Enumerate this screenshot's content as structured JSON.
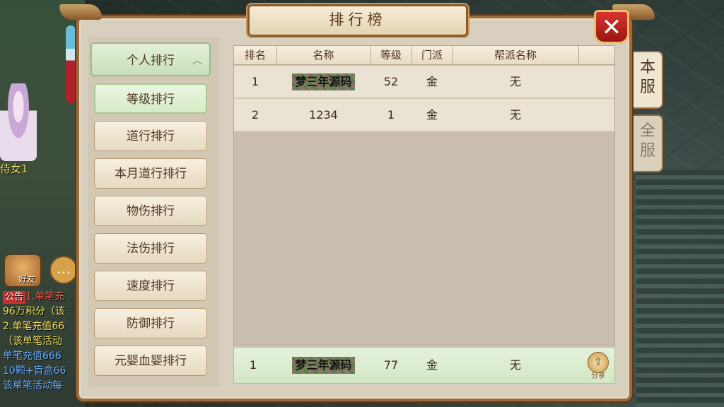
{
  "window": {
    "title": "排行榜",
    "close_label": "✕"
  },
  "menu": {
    "group_label": "个人排行",
    "items": [
      {
        "label": "等级排行",
        "active": true
      },
      {
        "label": "道行排行"
      },
      {
        "label": "本月道行排行"
      },
      {
        "label": "物伤排行"
      },
      {
        "label": "法伤排行"
      },
      {
        "label": "速度排行"
      },
      {
        "label": "防御排行"
      },
      {
        "label": "元婴血婴排行"
      }
    ]
  },
  "table": {
    "columns": [
      "排名",
      "名称",
      "等级",
      "门派",
      "帮派名称"
    ],
    "rows": [
      {
        "rank": "1",
        "name": "梦三年源码",
        "level": "52",
        "school": "金",
        "guild": "无",
        "masked": true
      },
      {
        "rank": "2",
        "name": "1234",
        "level": "1",
        "school": "金",
        "guild": "无",
        "masked": false
      }
    ]
  },
  "self_row": {
    "rank": "1",
    "name": "梦三年源码",
    "level": "77",
    "school": "金",
    "guild": "无"
  },
  "share": {
    "label": "分享"
  },
  "tabs": [
    {
      "label": "本\n服",
      "c1": "本",
      "c2": "服"
    },
    {
      "label": "全\n服",
      "c1": "全",
      "c2": "服"
    }
  ],
  "background": {
    "npc_name": "侍女1",
    "friend_label": "好友",
    "chat_icon": "…",
    "chat_tag": "公告",
    "chat_lines": [
      "1.单笔充",
      "96万积分（该",
      "2.单笔充值66",
      "（该单笔活动",
      "单笔充值666",
      "10颗+盲盒66",
      "该单笔活动每"
    ]
  }
}
